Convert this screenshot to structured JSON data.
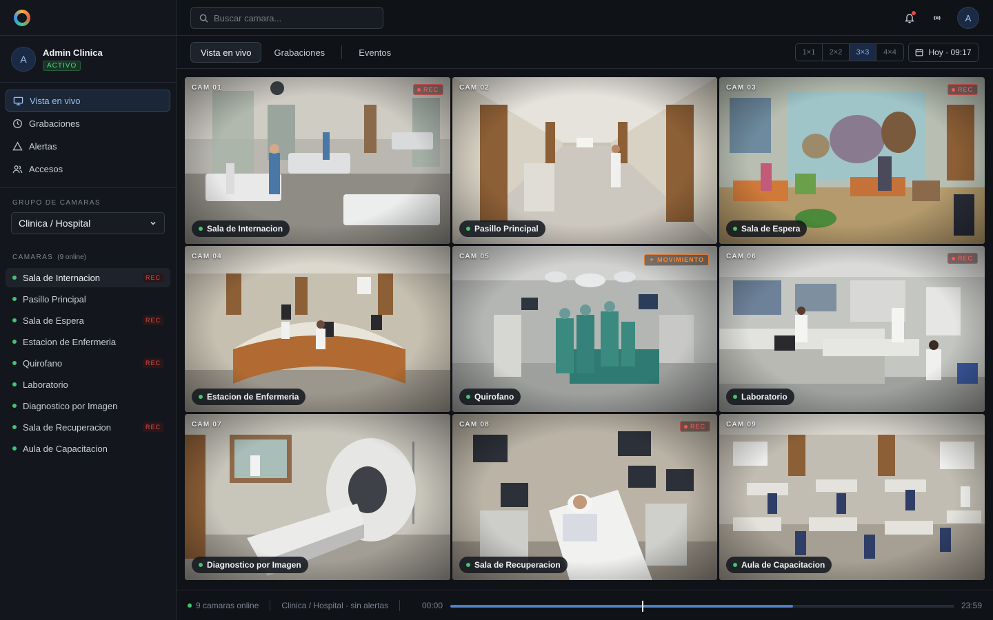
{
  "colors": {
    "accent": "#4f7fc8",
    "online": "#46c36e",
    "rec": "#e04848",
    "alert": "#d9823a"
  },
  "user": {
    "initial": "A",
    "name": "Admin Clinica",
    "status": "ACTIVO"
  },
  "nav": [
    {
      "label": "Vista en vivo",
      "icon": "monitor-icon"
    },
    {
      "label": "Grabaciones",
      "icon": "clock-icon"
    },
    {
      "label": "Alertas",
      "icon": "alert-triangle-icon"
    },
    {
      "label": "Accesos",
      "icon": "users-icon"
    }
  ],
  "group": {
    "label": "GRUPO DE CAMARAS",
    "selected": "Clinica / Hospital"
  },
  "cameras_section": {
    "label": "CAMARAS",
    "count": "(9 online)"
  },
  "cameras": [
    {
      "name": "Sala de Internacion",
      "rec": "REC"
    },
    {
      "name": "Pasillo Principal",
      "rec": ""
    },
    {
      "name": "Sala de Espera",
      "rec": "REC"
    },
    {
      "name": "Estacion de Enfermeria",
      "rec": ""
    },
    {
      "name": "Quirofano",
      "rec": "REC"
    },
    {
      "name": "Laboratorio",
      "rec": ""
    },
    {
      "name": "Diagnostico por Imagen",
      "rec": ""
    },
    {
      "name": "Sala de Recuperacion",
      "rec": "REC"
    },
    {
      "name": "Aula de Capacitacion",
      "rec": ""
    }
  ],
  "search": {
    "placeholder": "Buscar camara..."
  },
  "topbar": {
    "avatar": "A"
  },
  "tabs": [
    "Vista en vivo",
    "Grabaciones",
    "Eventos"
  ],
  "grid_options": [
    "1×1",
    "2×2",
    "3×3",
    "4×4"
  ],
  "grid_selected": "3×3",
  "date": "Hoy · 09:17",
  "tiles": [
    {
      "id": "CAM 01",
      "label": "Sala de Internacion",
      "badge": "REC"
    },
    {
      "id": "CAM 02",
      "label": "Pasillo Principal",
      "badge": ""
    },
    {
      "id": "CAM 03",
      "label": "Sala de Espera",
      "badge": "REC"
    },
    {
      "id": "CAM 04",
      "label": "Estacion de Enfermeria",
      "badge": ""
    },
    {
      "id": "CAM 05",
      "label": "Quirofano",
      "badge": "MOVIMIENTO"
    },
    {
      "id": "CAM 06",
      "label": "Laboratorio",
      "badge": "REC"
    },
    {
      "id": "CAM 07",
      "label": "Diagnostico por Imagen",
      "badge": ""
    },
    {
      "id": "CAM 08",
      "label": "Sala de Recuperacion",
      "badge": "REC"
    },
    {
      "id": "CAM 09",
      "label": "Aula de Capacitacion",
      "badge": ""
    }
  ],
  "status": {
    "online": "9 camaras online",
    "summary": "Clinica / Hospital · sin alertas",
    "start": "00:00",
    "end": "23:59",
    "playhead_fraction": 0.382,
    "buffer_fraction": 0.68
  }
}
